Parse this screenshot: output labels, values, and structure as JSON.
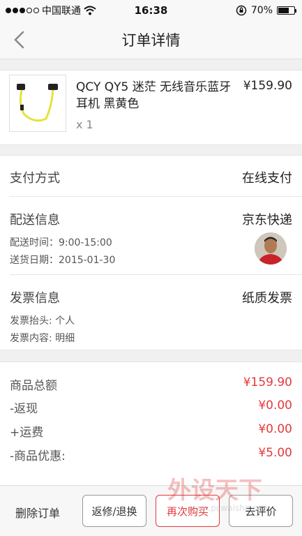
{
  "status_bar": {
    "carrier": "中国联通",
    "time": "16:38",
    "battery": "70%",
    "battery_level": 0.7
  },
  "nav": {
    "title": "订单详情"
  },
  "product": {
    "name": "QCY QY5 迷茫 无线音乐蓝牙耳机 黑黄色",
    "quantity": "x 1",
    "price": "¥159.90"
  },
  "payment": {
    "label": "支付方式",
    "value": "在线支付"
  },
  "delivery": {
    "label": "配送信息",
    "value": "京东快递",
    "time": "配送时间：9:00-15:00",
    "date": "送货日期：2015-01-30"
  },
  "invoice": {
    "label": "发票信息",
    "value": "纸质发票",
    "title": "发票抬头: 个人",
    "content": "发票内容: 明细"
  },
  "totals": [
    {
      "label": "商品总额",
      "value": "¥159.90"
    },
    {
      "label": "-返现",
      "value": "¥0.00"
    },
    {
      "label": "+运费",
      "value": "¥0.00"
    },
    {
      "label": "-商品优惠:",
      "value": "¥5.00"
    }
  ],
  "footer": {
    "delete_label": "删除订单",
    "return_label": "返修/退换",
    "rebuy_label": "再次购买",
    "review_label": "去评价"
  },
  "colors": {
    "accent": "#e4393c"
  }
}
